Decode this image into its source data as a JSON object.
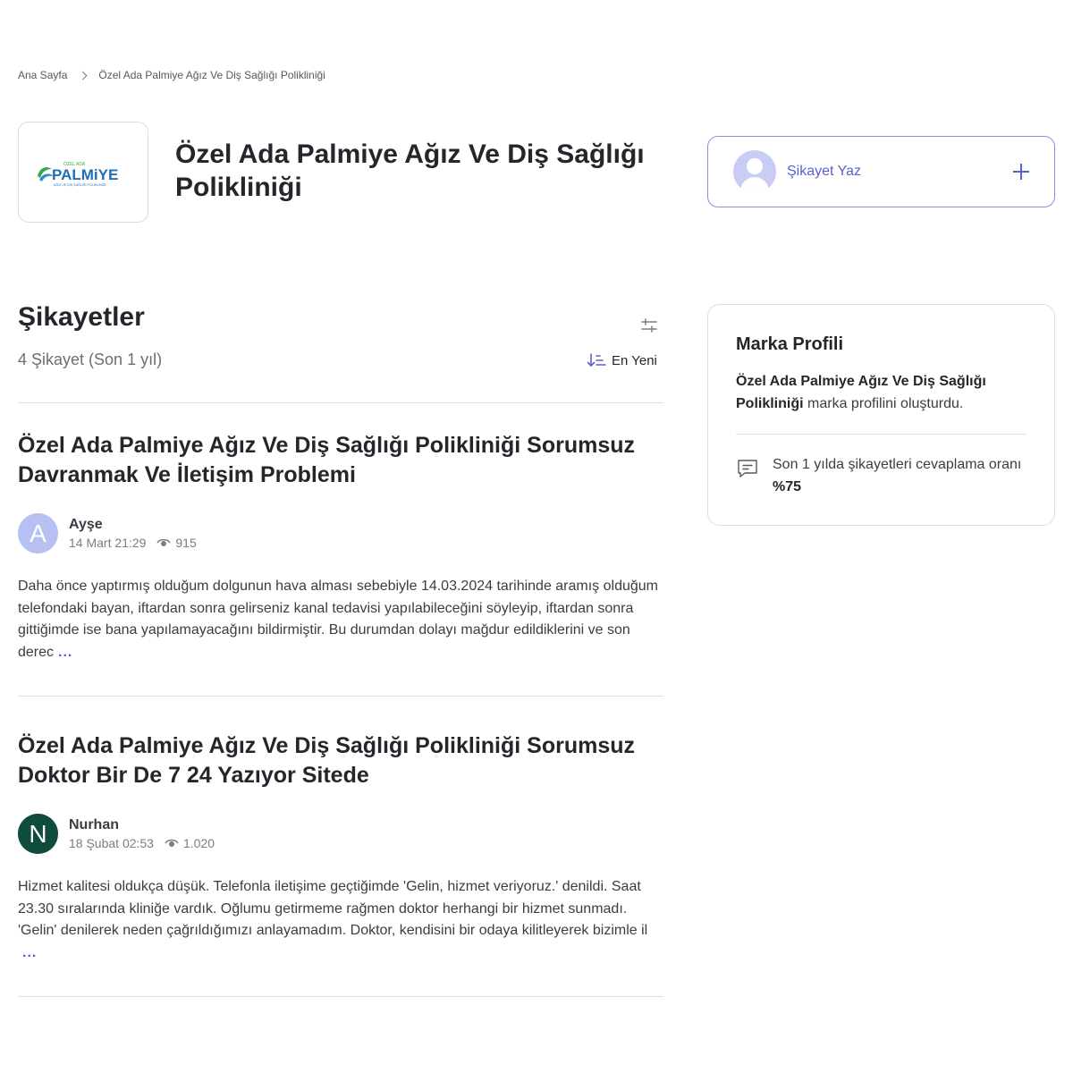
{
  "breadcrumb": {
    "home": "Ana Sayfa",
    "current": "Özel Ada Palmiye Ağız Ve Diş Sağlığı Polikliniği"
  },
  "brand": {
    "name": "Özel Ada Palmiye Ağız Ve Diş Sağlığı Polikliniği",
    "logo_text": "PALMiYE",
    "logo_small_top": "ÖZEL ADA",
    "logo_small_bottom": "AĞIZ VE DİŞ SAĞLIĞI POLİKLİNİĞİ",
    "logo_color": "#1f6fb5",
    "logo_leaf_color": "#3aa84a"
  },
  "write_complaint": {
    "label": "Şikayet Yaz"
  },
  "complaints_section": {
    "title": "Şikayetler",
    "subtitle": "4 Şikayet (Son 1 yıl)",
    "sort_label": "En Yeni"
  },
  "complaints": [
    {
      "title": "Özel Ada Palmiye Ağız Ve Diş Sağlığı Polikliniği Sorumsuz Davranmak Ve İletişim Problemi",
      "author": "Ayşe",
      "avatar_letter": "A",
      "avatar_color": "#b7c0f3",
      "date": "14 Mart 21:29",
      "views": "915",
      "text": "Daha önce yaptırmış olduğum dolgunun hava alması sebebiyle 14.03.2024 tarihinde aramış olduğum telefondaki bayan, iftardan sonra gelirseniz kanal tedavisi yapılabileceğini söyleyip, iftardan sonra gittiğimde ise bana yapılamayacağını bildirmiştir. Bu durumdan dolayı mağdur edildiklerini ve son derec",
      "more": "..."
    },
    {
      "title": "Özel Ada Palmiye Ağız Ve Diş Sağlığı Polikliniği Sorumsuz Doktor Bir De 7 24 Yazıyor Sitede",
      "author": "Nurhan",
      "avatar_letter": "N",
      "avatar_color": "#0f4c3e",
      "date": "18 Şubat 02:53",
      "views": "1.020",
      "text": "Hizmet kalitesi oldukça düşük. Telefonla iletişime geçtiğimde 'Gelin, hizmet veriyoruz.' denildi. Saat 23.30 sıralarında kliniğe vardık. Oğlumu getirmeme rağmen doktor herhangi bir hizmet sunmadı. 'Gelin' denilerek neden çağrıldığımızı anlayamadım. Doktor, kendisini bir odaya kilitleyerek bizimle il",
      "more": "..."
    }
  ],
  "brand_profile": {
    "title": "Marka Profili",
    "brand_name": "Özel Ada Palmiye Ağız Ve Diş Sağlığı Polikliniği",
    "created_text": "marka profilini oluşturdu.",
    "rate_text": "Son 1 yılda şikayetleri cevaplama oranı",
    "rate_value": "%75"
  },
  "colors": {
    "accent": "#5b5fd1",
    "border": "#dcdde1",
    "text": "#24262b"
  }
}
